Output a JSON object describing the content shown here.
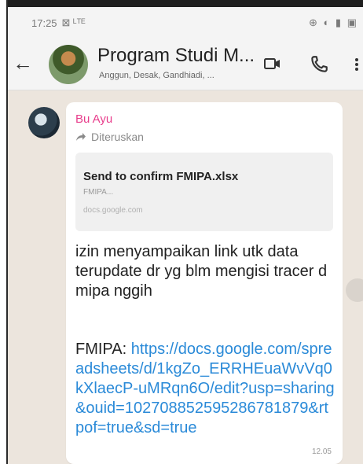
{
  "status_bar": {
    "time": "17:25",
    "extra": "⊠ ᴸᵀᴱ",
    "right_icons": "⊕ ◐ ▮ ▣"
  },
  "header": {
    "back_icon": "arrow-left",
    "title": "Program Studi M...",
    "subtitle": "Anggun, Desak, Gandhiadi, ...",
    "video_icon": "video-camera",
    "call_icon": "phone"
  },
  "message": {
    "sender": "Bu Ayu",
    "forwarded_label": "Diteruskan",
    "preview": {
      "title": "Send to confirm FMIPA.xlsx",
      "description": "FMIPA...",
      "domain": "docs.google.com"
    },
    "text": "izin menyampaikan link utk data terupdate dr yg blm mengisi tracer d mipa nggih",
    "link_prefix": "FMIPA: ",
    "link": "https://docs.google.com/spreadsheets/d/1kgZo_ERRHEuaWvVq0kXlaecP-uMRqn6O/edit?usp=sharing&ouid=102708852595286781879&rtpof=true&sd=true",
    "time": "12.05"
  },
  "colors": {
    "sender_name": "#e83e8c",
    "link": "#2a8ad8",
    "chat_background": "#ece5dd"
  }
}
